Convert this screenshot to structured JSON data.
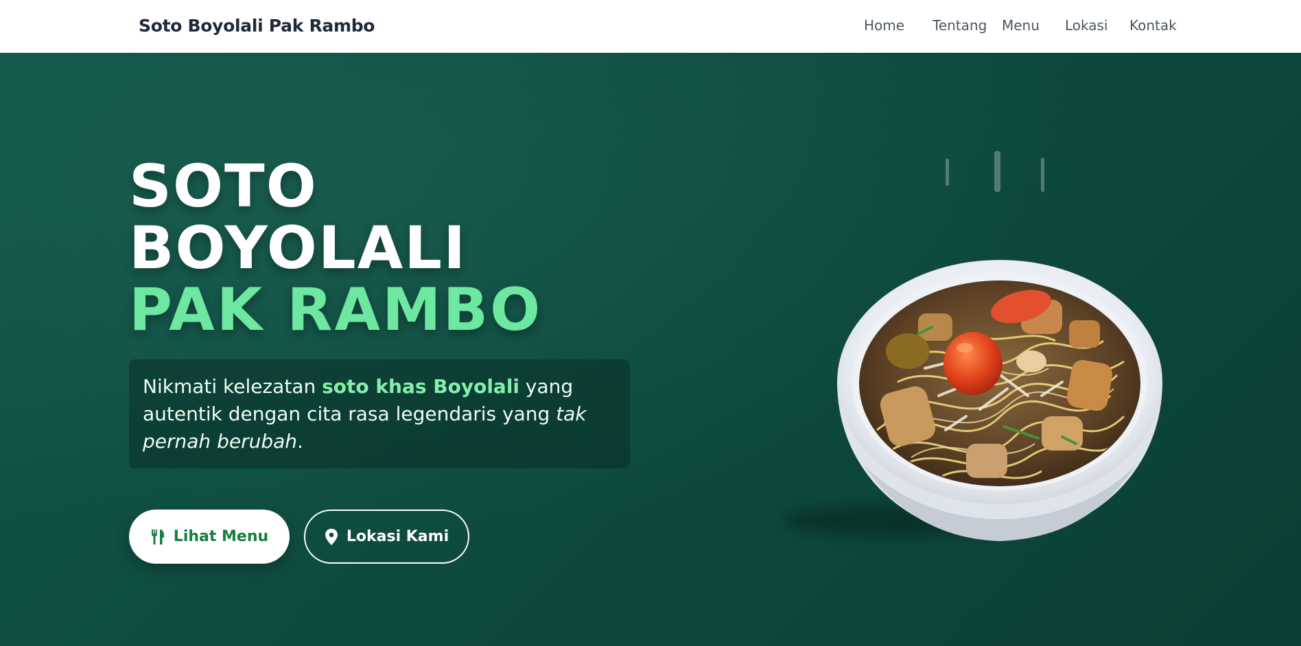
{
  "nav": {
    "brand": "Soto Boyolali Pak Rambo",
    "links": [
      "Home",
      "Tentang",
      "Menu",
      "Lokasi",
      "Kontak"
    ]
  },
  "hero": {
    "title_line1": "SOTO",
    "title_line2": "BOYOLALI",
    "title_accent": "PAK RAMBO",
    "desc": {
      "part1": "Nikmati kelezatan ",
      "highlight": "soto khas Boyolali",
      "part2": " yang autentik dengan cita rasa legendaris yang ",
      "italic": "tak pernah berubah",
      "part3": "."
    },
    "buttons": {
      "menu": "Lihat Menu",
      "location": "Lokasi Kami"
    },
    "image": "bowl of soto with noodles, tomato and toppings"
  },
  "colors": {
    "hero_bg": "#0f4a3f",
    "accent_green": "#6ee7a1",
    "button_text_green": "#15803d",
    "nav_bg": "#ffffff"
  },
  "icons": {
    "menu_button": "utensils-icon",
    "location_button": "map-pin-icon"
  }
}
